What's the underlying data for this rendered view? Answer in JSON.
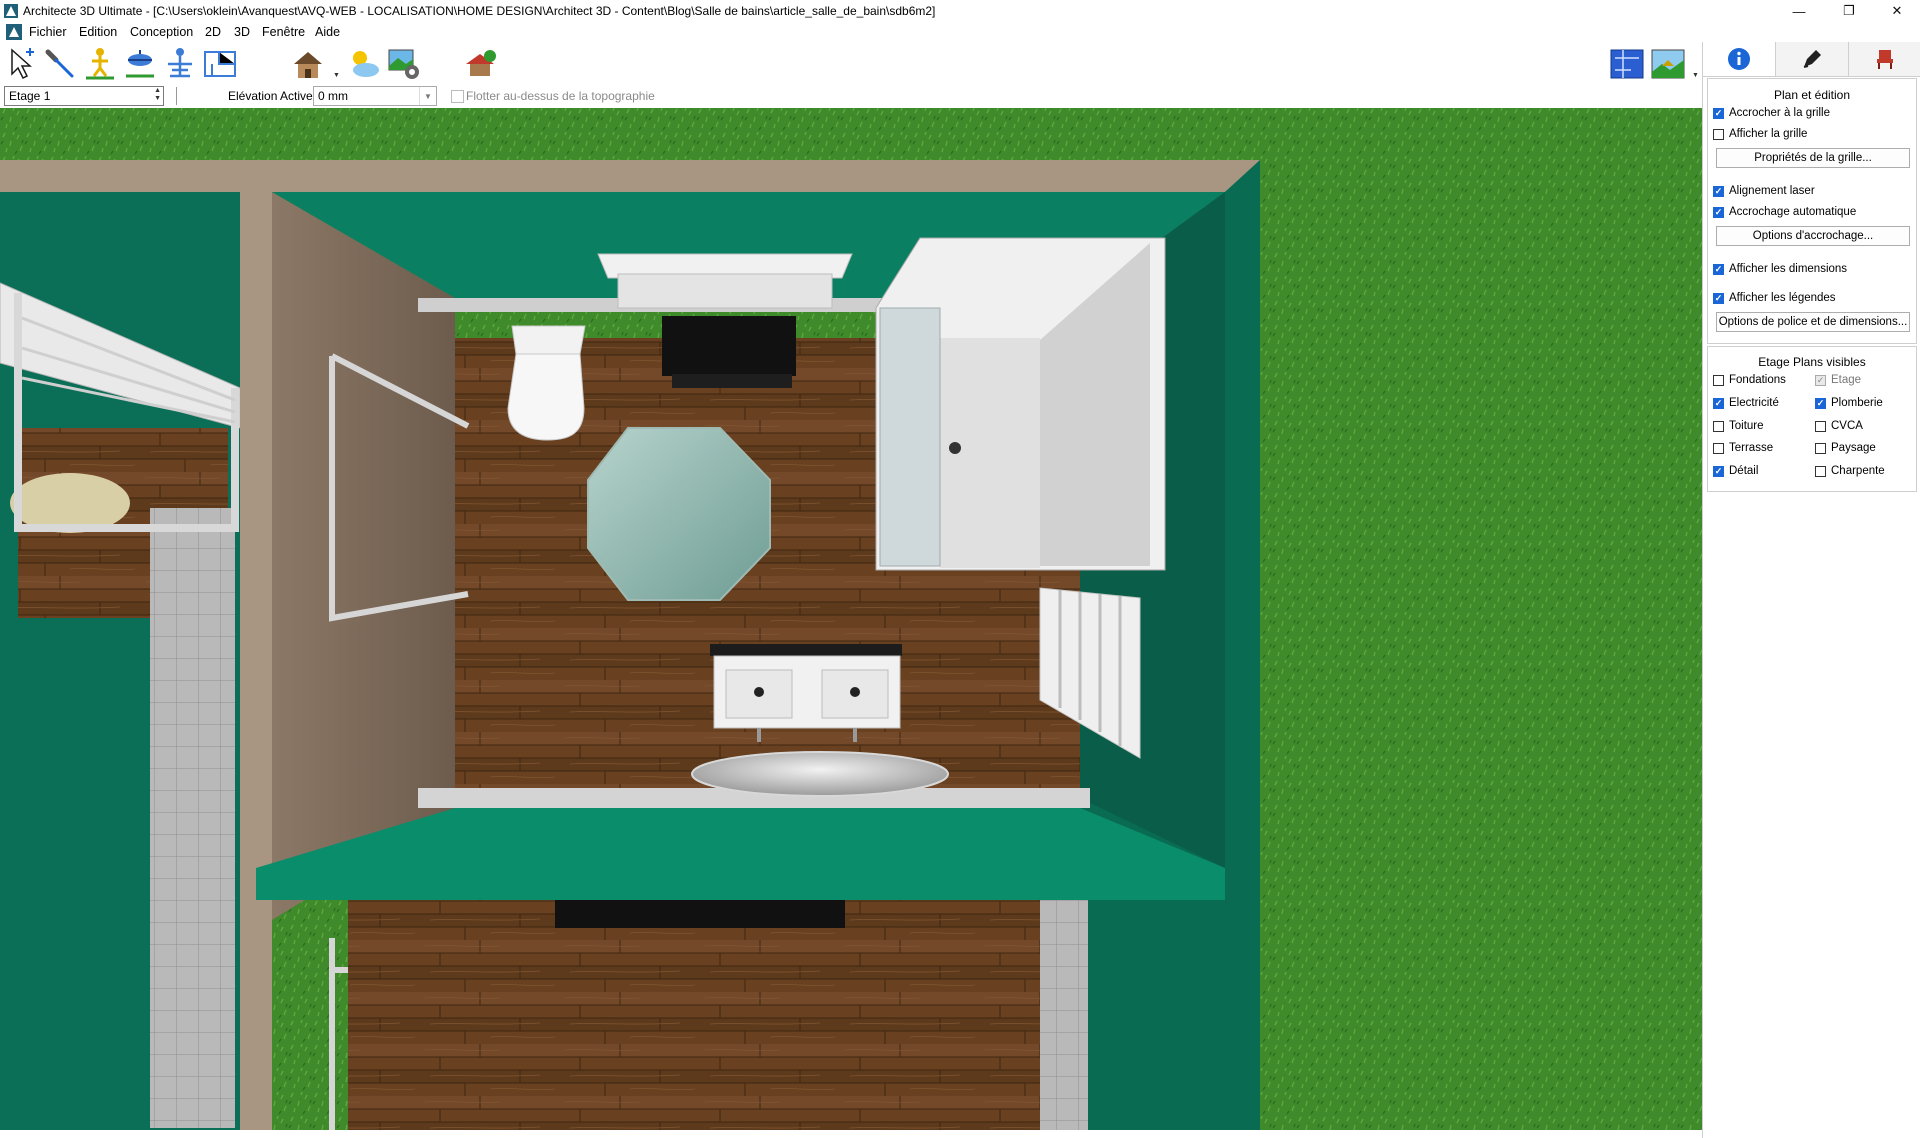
{
  "window": {
    "title": "Architecte 3D Ultimate - [C:\\Users\\oklein\\Avanquest\\AVQ-WEB - LOCALISATION\\HOME DESIGN\\Architect 3D - Content\\Blog\\Salle de bains\\article_salle_de_bain\\sdb6m2]",
    "minimize": "—",
    "restore": "❐",
    "close": "✕"
  },
  "menu": {
    "items": [
      "Fichier",
      "Edition",
      "Conception",
      "2D",
      "3D",
      "Fenêtre",
      "Aide"
    ],
    "mdi_controls": [
      "–",
      "❐",
      "✕"
    ]
  },
  "options_bar": {
    "floor_value": "Etage 1",
    "elevation_label": "Elévation Active:",
    "elevation_value": "0 mm",
    "float_label": "Flotter au-dessus de la topographie"
  },
  "panel": {
    "title": "Plan et édition",
    "grid_snap": {
      "label": "Accrocher à la grille",
      "checked": true
    },
    "grid_show": {
      "label": "Afficher la grille",
      "checked": false
    },
    "grid_button": "Propriétés de la grille...",
    "laser": {
      "label": "Alignement laser",
      "checked": true
    },
    "auto_snap": {
      "label": "Accrochage automatique",
      "checked": true
    },
    "snap_button": "Options d'accrochage...",
    "dimensions": {
      "label": "Afficher les dimensions",
      "checked": true
    },
    "legends": {
      "label": "Afficher les légendes",
      "checked": true
    },
    "font_button": "Options de police et de dimensions...",
    "layers_title": "Etage Plans visibles",
    "layers": [
      {
        "label": "Fondations",
        "checked": false
      },
      {
        "label": "Etage",
        "checked": true,
        "disabled": true
      },
      {
        "label": "Electricité",
        "checked": true
      },
      {
        "label": "Plomberie",
        "checked": true
      },
      {
        "label": "Toiture",
        "checked": false
      },
      {
        "label": "CVCA",
        "checked": false
      },
      {
        "label": "Terrasse",
        "checked": false
      },
      {
        "label": "Paysage",
        "checked": false
      },
      {
        "label": "Détail",
        "checked": true
      },
      {
        "label": "Charpente",
        "checked": false
      }
    ]
  },
  "colors": {
    "wall_green": "#0b7f62",
    "floor_wood": "#6a4120",
    "grass": "#3f8a2a",
    "accent_blue": "#1a66d6"
  }
}
